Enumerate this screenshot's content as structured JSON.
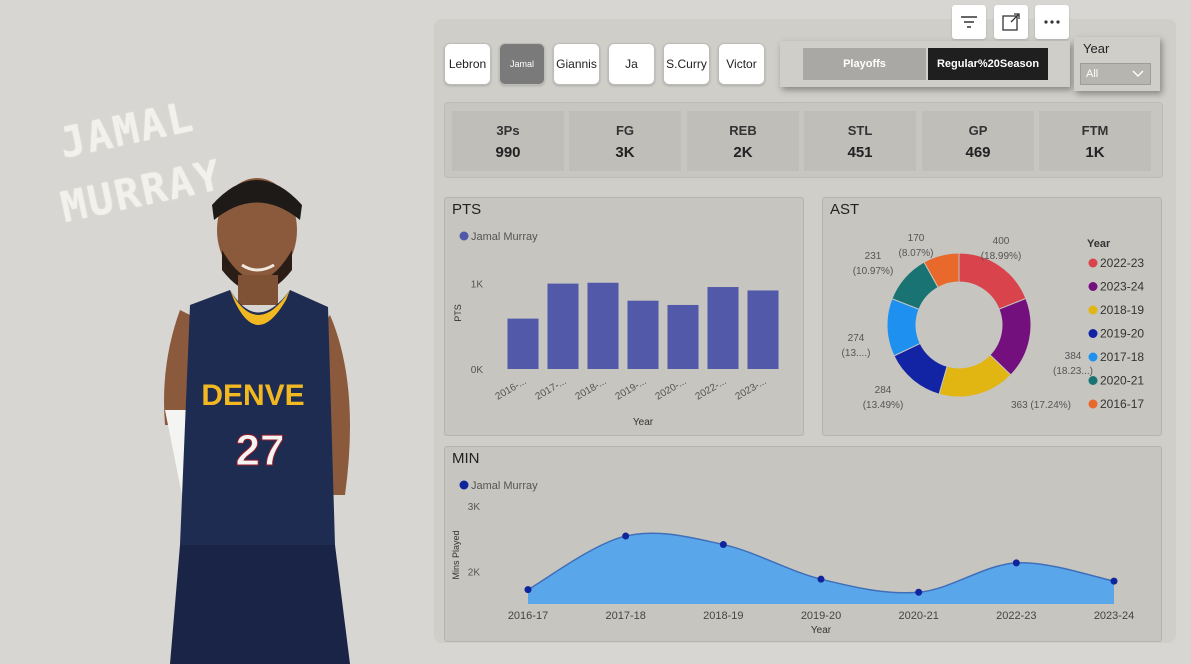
{
  "hero": {
    "name_line1": "JAMAL",
    "name_line2": "MURRAY"
  },
  "toolbar": {
    "icons": [
      "filter-icon",
      "focus-mode-icon",
      "more-options-icon"
    ]
  },
  "players": [
    {
      "label": "Lebron",
      "active": false
    },
    {
      "label": "Jamal",
      "active": true
    },
    {
      "label": "Giannis",
      "active": false
    },
    {
      "label": "Ja",
      "active": false
    },
    {
      "label": "S.Curry",
      "active": false
    },
    {
      "label": "Victor",
      "active": false
    }
  ],
  "season": {
    "playoffs": "Playoffs",
    "regular": "Regular%20Season",
    "selected": "regular"
  },
  "year_filter": {
    "label": "Year",
    "value": "All"
  },
  "kpis": [
    {
      "label": "3Ps",
      "value": "990"
    },
    {
      "label": "FG",
      "value": "3K"
    },
    {
      "label": "REB",
      "value": "2K"
    },
    {
      "label": "STL",
      "value": "451"
    },
    {
      "label": "GP",
      "value": "469"
    },
    {
      "label": "FTM",
      "value": "1K"
    }
  ],
  "chart_data": [
    {
      "type": "bar",
      "title": "PTS",
      "legend": "Jamal Murray",
      "categories": [
        "2016-...",
        "2017-...",
        "2018-...",
        "2019-...",
        "2020-...",
        "2022-...",
        "2023-..."
      ],
      "values": [
        590,
        1000,
        1010,
        800,
        750,
        960,
        920
      ],
      "ylim": [
        0,
        1300
      ],
      "yticks": [
        {
          "v": 0,
          "t": "0K"
        },
        {
          "v": 1000,
          "t": "1K"
        }
      ],
      "xlabel": "Year",
      "ylabel": "PTS",
      "color": "#5159a8"
    },
    {
      "type": "pie",
      "title": "AST",
      "legend_title": "Year",
      "slices": [
        {
          "label": "2022-23",
          "value": 400,
          "pct": "(18.99%)",
          "color": "#d9434b"
        },
        {
          "label": "2023-24",
          "value": 384,
          "pct": "(18.23...)",
          "color": "#74107e"
        },
        {
          "label": "2018-19",
          "value": 363,
          "pct": "(17.24%)",
          "color": "#e1b512"
        },
        {
          "label": "2019-20",
          "value": 284,
          "pct": "(13.49%)",
          "color": "#1224a3"
        },
        {
          "label": "2017-18",
          "value": 274,
          "pct": "(13....)",
          "color": "#1e90f0"
        },
        {
          "label": "2020-21",
          "value": 231,
          "pct": "(10.97%)",
          "color": "#197373"
        },
        {
          "label": "2016-17",
          "value": 170,
          "pct": "(8.07%)",
          "color": "#e9682c"
        }
      ]
    },
    {
      "type": "area",
      "title": "MIN",
      "legend": "Jamal Murray",
      "categories": [
        "2016-17",
        "2017-18",
        "2018-19",
        "2019-20",
        "2020-21",
        "2022-23",
        "2023-24"
      ],
      "values": [
        1720,
        2540,
        2410,
        1880,
        1680,
        2130,
        1850
      ],
      "ylim": [
        1500,
        3000
      ],
      "yticks": [
        {
          "v": 2000,
          "t": "2K"
        },
        {
          "v": 3000,
          "t": "3K"
        }
      ],
      "xlabel": "Year",
      "ylabel": "Mins Played",
      "fill": "#5aa6ea",
      "point_color": "#10249c"
    }
  ]
}
